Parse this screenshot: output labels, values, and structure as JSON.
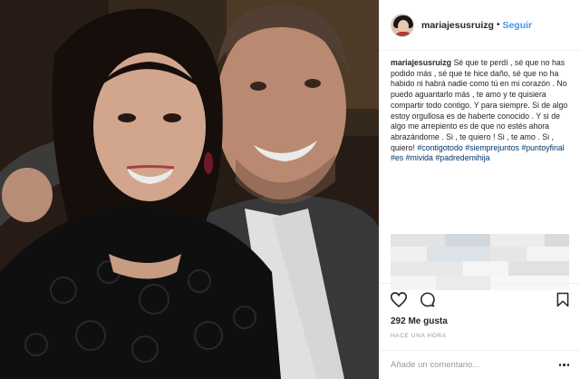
{
  "post": {
    "username": "mariajesusruizg",
    "separator": "•",
    "follow_label": "Seguir",
    "caption_author": "mariajesusruizg",
    "caption_text": "Sé que te perdí , sé que no has podido más , sé que te hice daño, sé que no ha habido ni habrá nadie como tú en mi corazón . No puedo aguantarlo más , te amo y te quisiera compartir todo contigo. Y para siempre. Si de algo estoy orgullosa es de haberte conocido . Y si de algo me arrepiento es de que no estés ahora abrazándome . Si , te quiero ! Si , te amo . Si , quiero!",
    "hashtags": [
      "#contigotodo",
      "#siemprejuntos",
      "#puntoyfinal",
      "#es",
      "#mivida",
      "#padredemihija"
    ],
    "likes": "292 Me gusta",
    "timestamp": "HACE UNA HORA",
    "comment_placeholder": "Añade un comentario..."
  },
  "icons": {
    "heart": "heart-icon",
    "comment": "comment-icon",
    "bookmark": "bookmark-icon",
    "more": "more-options-icon"
  },
  "colors": {
    "link_blue": "#3897f0",
    "hashtag": "#003569",
    "text": "#262626",
    "muted": "#999999",
    "border": "#efefef"
  }
}
